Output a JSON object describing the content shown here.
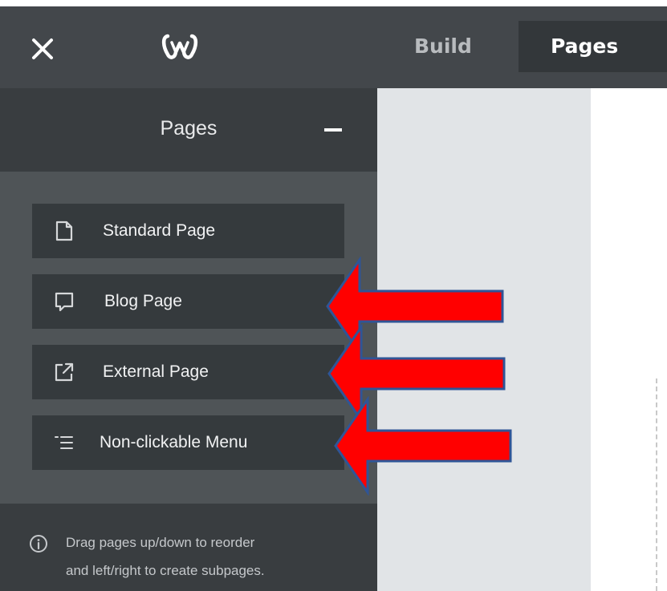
{
  "topbar": {
    "tabs": [
      {
        "label": "Build"
      },
      {
        "label": "Pages"
      }
    ]
  },
  "panel": {
    "title": "Pages",
    "items": [
      {
        "label": "Standard Page",
        "icon": "document-icon"
      },
      {
        "label": "Blog Page",
        "icon": "speech-bubble-icon"
      },
      {
        "label": "External Page",
        "icon": "external-link-icon"
      },
      {
        "label": "Non-clickable Menu",
        "icon": "list-icon"
      }
    ],
    "info": {
      "line1": "Drag pages up/down to reorder",
      "line2": "and left/right to create subpages."
    }
  },
  "colors": {
    "topbar_bg": "#43474b",
    "active_tab_bg": "#33373a",
    "panel_bg": "#4f5457",
    "panel_header_bg": "#393d40",
    "item_bg": "#353a3d",
    "canvas_gray": "#e1e4e7",
    "annotation_arrow_fill": "#ff0000",
    "annotation_arrow_stroke": "#2f5597"
  }
}
